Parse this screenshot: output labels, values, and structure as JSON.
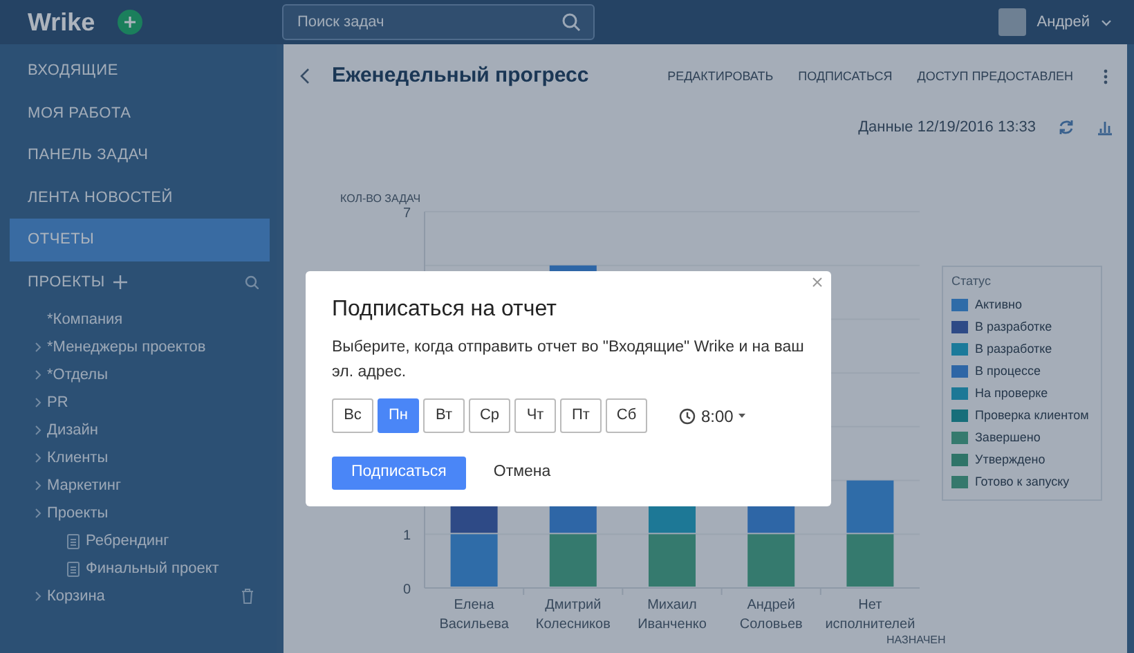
{
  "topbar": {
    "logo": "Wrike",
    "search": {
      "placeholder": "Поиск задач"
    },
    "user": {
      "name": "Андрей"
    }
  },
  "sidebar": {
    "items": [
      {
        "label": "ВХОДЯЩИЕ",
        "selected": false
      },
      {
        "label": "МОЯ РАБОТА",
        "selected": false
      },
      {
        "label": "ПАНЕЛЬ ЗАДАЧ",
        "selected": false
      },
      {
        "label": "ЛЕНТА НОВОСТЕЙ",
        "selected": false
      },
      {
        "label": "ОТЧЕТЫ",
        "selected": true
      }
    ],
    "projects": {
      "label": "ПРОЕКТЫ",
      "tree": [
        {
          "label": "*Компания",
          "kind": "space"
        },
        {
          "label": "*Менеджеры проектов",
          "kind": "folder"
        },
        {
          "label": "*Отделы",
          "kind": "folder"
        },
        {
          "label": "PR",
          "kind": "folder"
        },
        {
          "label": "Дизайн",
          "kind": "folder"
        },
        {
          "label": "Клиенты",
          "kind": "folder"
        },
        {
          "label": "Маркетинг",
          "kind": "folder"
        },
        {
          "label": "Проекты",
          "kind": "folder",
          "children": [
            {
              "label": "Ребрендинг",
              "kind": "project"
            },
            {
              "label": "Финальный проект",
              "kind": "project"
            }
          ]
        },
        {
          "label": "Корзина",
          "kind": "trash"
        }
      ]
    }
  },
  "report": {
    "title": "Еженедельный прогресс",
    "actions": [
      "РЕДАКТИРОВАТЬ",
      "ПОДПИСАТЬСЯ",
      "ДОСТУП ПРЕДОСТАВЛЕН"
    ],
    "updated": "Данные 12/19/2016 13:33",
    "chart": {
      "y_axis_title": "КОЛ-ВО ЗАДАЧ",
      "y_tick_labels": [
        "7",
        "1",
        "0"
      ],
      "categories": [
        "Елена Васильева",
        "Дмитрий Колесников",
        "Михаил Иванченко",
        "Андрей Соловьев",
        "Нет исполнителей"
      ],
      "x_axis_title": "НАЗНАЧЕН",
      "legend": {
        "title": "Статус",
        "items": [
          {
            "label": "Активно",
            "color": "#2f6ca8"
          },
          {
            "label": "В разработке",
            "color": "#2e4a86"
          },
          {
            "label": "В разработке",
            "color": "#1b7a9a"
          },
          {
            "label": "В процессе",
            "color": "#2e66a6"
          },
          {
            "label": "На проверке",
            "color": "#1d7896"
          },
          {
            "label": "Проверка клиентом",
            "color": "#176e7a"
          },
          {
            "label": "Завершено",
            "color": "#357a6e"
          },
          {
            "label": "Утверждено",
            "color": "#2f7468"
          },
          {
            "label": "Готово к запуску",
            "color": "#35786c"
          }
        ]
      }
    }
  },
  "dialog": {
    "title": "Подписаться на отчет",
    "text": "Выберите, когда отправить отчет во \"Входящие\" Wrike и на ваш эл. адрес.",
    "days": [
      {
        "label": "Вс",
        "selected": false
      },
      {
        "label": "Пн",
        "selected": true
      },
      {
        "label": "Вт",
        "selected": false
      },
      {
        "label": "Ср",
        "selected": false
      },
      {
        "label": "Чт",
        "selected": false
      },
      {
        "label": "Пт",
        "selected": false
      },
      {
        "label": "Сб",
        "selected": false
      }
    ],
    "time": "8:00",
    "buttons": [
      {
        "label": "Подписаться",
        "kind": "primary"
      },
      {
        "label": "Отмена",
        "kind": "link"
      }
    ]
  }
}
